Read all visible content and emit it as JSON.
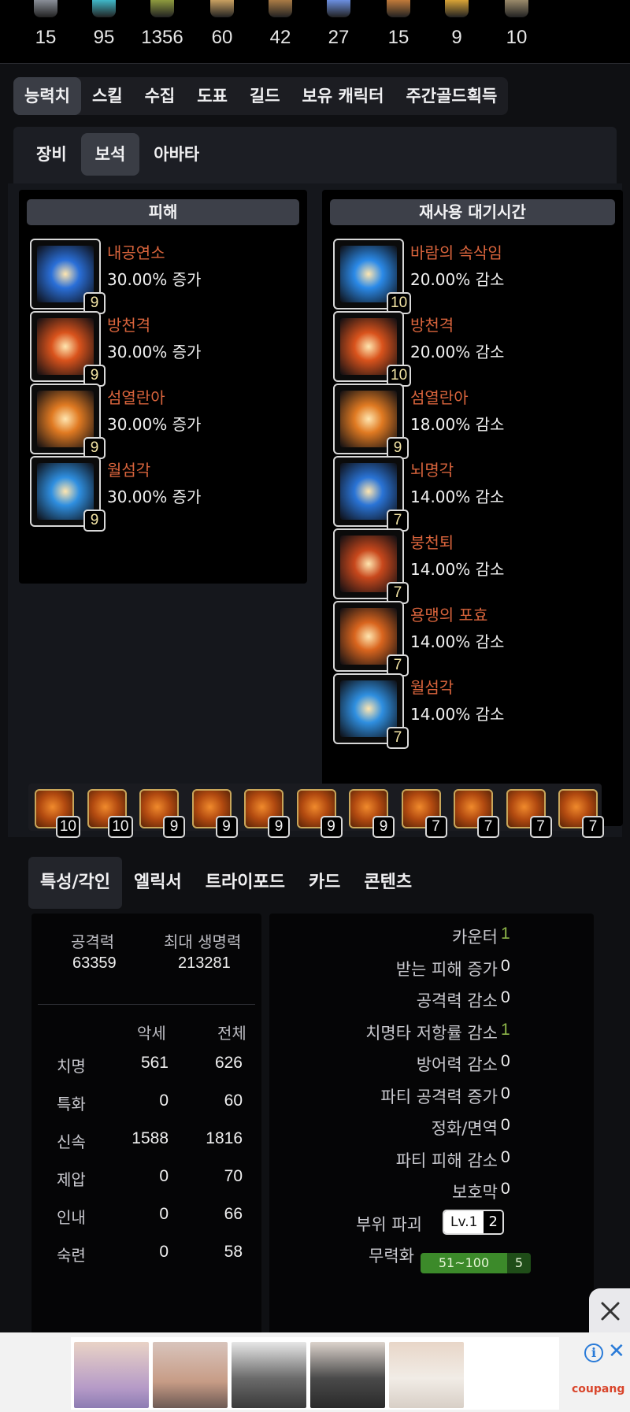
{
  "resources": [
    {
      "icon": "silver-coin-icon",
      "count": "15",
      "color": "#8a8f98"
    },
    {
      "icon": "blue-gem-icon",
      "count": "95",
      "color": "#3fb7c8"
    },
    {
      "icon": "green-stone-icon",
      "count": "1356",
      "color": "#8e9a3e"
    },
    {
      "icon": "book-icon",
      "count": "60",
      "color": "#c8a060"
    },
    {
      "icon": "scroll-icon",
      "count": "42",
      "color": "#a97b45"
    },
    {
      "icon": "crystal-flower-icon",
      "count": "27",
      "color": "#6b8fe0"
    },
    {
      "icon": "shield-emblem-icon",
      "count": "15",
      "color": "#c07a3a"
    },
    {
      "icon": "gold-star-icon",
      "count": "9",
      "color": "#d8a336"
    },
    {
      "icon": "orb-icon",
      "count": "10",
      "color": "#9a8a6a"
    }
  ],
  "main_tabs": [
    "능력치",
    "스킬",
    "수집",
    "도표",
    "길드",
    "보유 캐릭터",
    "주간골드획득"
  ],
  "sub_tabs": [
    "장비",
    "보석",
    "아바타"
  ],
  "damage_column": {
    "title": "피해",
    "gems": [
      {
        "name": "내공연소",
        "effect": "30.00% 증가",
        "level": "9",
        "icon": "swirl-vortex-icon",
        "color": "#2a6fd8"
      },
      {
        "name": "방천격",
        "effect": "30.00% 증가",
        "level": "9",
        "icon": "fire-kick-icon",
        "color": "#d9531c"
      },
      {
        "name": "섬열란아",
        "effect": "30.00% 증가",
        "level": "9",
        "icon": "fire-fist-icon",
        "color": "#e07a22"
      },
      {
        "name": "월섬각",
        "effect": "30.00% 증가",
        "level": "9",
        "icon": "crescent-slash-icon",
        "color": "#2f8fe0"
      }
    ]
  },
  "cooldown_column": {
    "title": "재사용 대기시간",
    "gems": [
      {
        "name": "바람의 속삭임",
        "effect": "20.00% 감소",
        "level": "10",
        "icon": "wind-dash-icon",
        "color": "#2b8ae8"
      },
      {
        "name": "방천격",
        "effect": "20.00% 감소",
        "level": "10",
        "icon": "fire-kick-icon",
        "color": "#d9531c"
      },
      {
        "name": "섬열란아",
        "effect": "18.00% 감소",
        "level": "9",
        "icon": "fire-fist-icon",
        "color": "#e07a22"
      },
      {
        "name": "뇌명각",
        "effect": "14.00% 감소",
        "level": "7",
        "icon": "lightning-icon",
        "color": "#2a74d6"
      },
      {
        "name": "붕천퇴",
        "effect": "14.00% 감소",
        "level": "7",
        "icon": "high-kick-icon",
        "color": "#c8481c"
      },
      {
        "name": "용맹의 포효",
        "effect": "14.00% 감소",
        "level": "7",
        "icon": "roar-blast-icon",
        "color": "#d9651e"
      },
      {
        "name": "월섬각",
        "effect": "14.00% 감소",
        "level": "7",
        "icon": "crescent-slash-icon",
        "color": "#2f8fe0"
      }
    ]
  },
  "gem_slots": [
    "10",
    "10",
    "9",
    "9",
    "9",
    "9",
    "9",
    "7",
    "7",
    "7",
    "7"
  ],
  "bottom_tabs": [
    "특성/각인",
    "엘릭서",
    "트라이포드",
    "카드",
    "콘텐츠"
  ],
  "summary": {
    "attack_label": "공격력",
    "attack_value": "63359",
    "hp_label": "최대 생명력",
    "hp_value": "213281",
    "col_acc": "악세",
    "col_total": "전체"
  },
  "stats": [
    {
      "label": "치명",
      "acc": "561",
      "total": "626"
    },
    {
      "label": "특화",
      "acc": "0",
      "total": "60"
    },
    {
      "label": "신속",
      "acc": "1588",
      "total": "1816"
    },
    {
      "label": "제압",
      "acc": "0",
      "total": "70"
    },
    {
      "label": "인내",
      "acc": "0",
      "total": "66"
    },
    {
      "label": "숙련",
      "acc": "0",
      "total": "58"
    }
  ],
  "effects": [
    {
      "label": "카운터",
      "value": "1"
    },
    {
      "label": "받는 피해 증가",
      "value": "0"
    },
    {
      "label": "공격력 감소",
      "value": "0"
    },
    {
      "label": "치명타 저항률 감소",
      "value": "1"
    },
    {
      "label": "방어력 감소",
      "value": "0"
    },
    {
      "label": "파티 공격력 증가",
      "value": "0"
    },
    {
      "label": "정화/면역",
      "value": "0"
    },
    {
      "label": "파티 피해 감소",
      "value": "0"
    },
    {
      "label": "보호막",
      "value": "0"
    },
    {
      "label": "부위 파괴",
      "badge_left": "Lv.1",
      "badge_right": "2"
    },
    {
      "label": "무력화",
      "bar": "51~100",
      "bar_right": "5"
    }
  ],
  "ad": {
    "brand": "coupang",
    "info": "i",
    "close": "✕"
  }
}
